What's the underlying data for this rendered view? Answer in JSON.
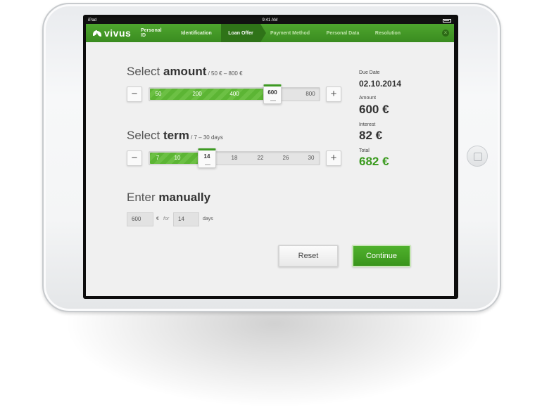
{
  "statusbar": {
    "device": "iPad",
    "time": "9:41 AM"
  },
  "nav": {
    "logo": "vivus",
    "steps": [
      {
        "label": "Personal ID",
        "state": "done"
      },
      {
        "label": "Identification",
        "state": "done"
      },
      {
        "label": "Loan Offer",
        "state": "active"
      },
      {
        "label": "Payment Method",
        "state": "todo"
      },
      {
        "label": "Personal Data",
        "state": "todo"
      },
      {
        "label": "Resolution",
        "state": "todo"
      }
    ],
    "close": "×"
  },
  "amount": {
    "heading_light": "Select ",
    "heading_bold": "amount",
    "range": " / 50 € – 800 €",
    "ticks": [
      "50",
      "200",
      "400",
      "800"
    ],
    "selected": "600",
    "minus": "−",
    "plus": "+"
  },
  "term": {
    "heading_light": "Select ",
    "heading_bold": "term",
    "range": " / 7 – 30 days",
    "ticks": [
      "7",
      "10",
      "18",
      "22",
      "26",
      "30"
    ],
    "selected": "14",
    "minus": "−",
    "plus": "+"
  },
  "manual": {
    "heading_light": "Enter ",
    "heading_bold": "manually",
    "amount_value": "600",
    "currency": "€",
    "for_label": "for",
    "days_value": "14",
    "days_label": "days"
  },
  "buttons": {
    "reset": "Reset",
    "continue": "Continue"
  },
  "summary": {
    "due_date_label": "Due Date",
    "due_date_value": "02.10.2014",
    "amount_label": "Amount",
    "amount_value": "600 €",
    "interest_label": "Interest",
    "interest_value": "82 €",
    "total_label": "Total",
    "total_value": "682 €"
  },
  "colors": {
    "brand_green": "#3a9a1e",
    "nav_active": "#2f7318"
  }
}
